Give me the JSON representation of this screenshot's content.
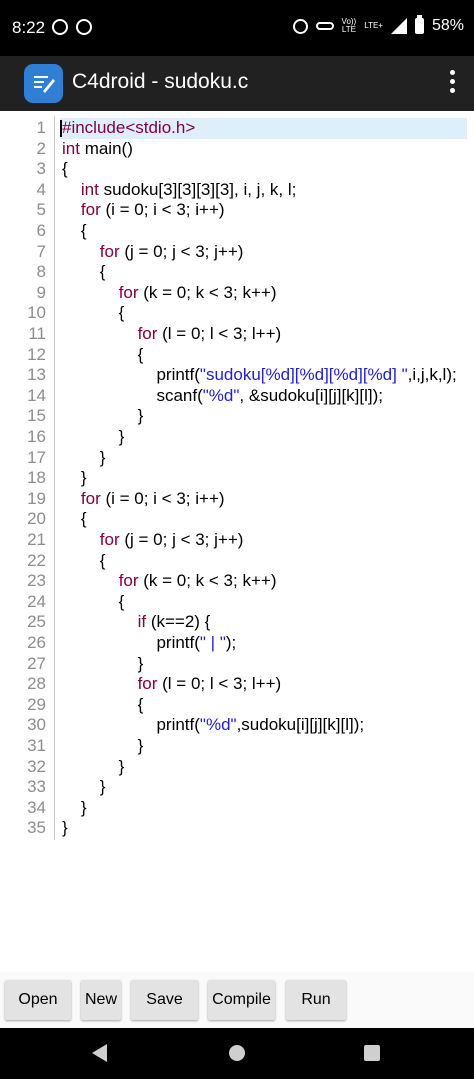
{
  "status_bar": {
    "time": "8:22",
    "network_label_top": "Vo))",
    "network_label_bottom": "LTE",
    "data_label": "LTE+",
    "battery": "58%"
  },
  "app_bar": {
    "title": "C4droid - sudoku.c",
    "logo_icon": "c4droid-app-icon",
    "menu_icon": "overflow-menu-icon"
  },
  "editor": {
    "current_line": 1,
    "lines": [
      {
        "n": "1",
        "segs": [
          [
            "pp",
            "#include<stdio.h>"
          ]
        ]
      },
      {
        "n": "2",
        "segs": [
          [
            "kw",
            "int"
          ],
          [
            "",
            "main()"
          ]
        ]
      },
      {
        "n": "3",
        "segs": [
          [
            "",
            "{"
          ]
        ]
      },
      {
        "n": "4",
        "segs": [
          [
            "",
            "    "
          ],
          [
            "kw",
            "int"
          ],
          [
            "",
            "sudoku[3][3][3][3], i, j, k, l;"
          ]
        ]
      },
      {
        "n": "5",
        "segs": [
          [
            "",
            "    "
          ],
          [
            "kw",
            "for"
          ],
          [
            "",
            "(i = 0; i < 3; i++)"
          ]
        ]
      },
      {
        "n": "6",
        "segs": [
          [
            "",
            "    {"
          ]
        ]
      },
      {
        "n": "7",
        "segs": [
          [
            "",
            "        "
          ],
          [
            "kw",
            "for"
          ],
          [
            "",
            "(j = 0; j < 3; j++)"
          ]
        ]
      },
      {
        "n": "8",
        "segs": [
          [
            "",
            "        {"
          ]
        ]
      },
      {
        "n": "9",
        "segs": [
          [
            "",
            "            "
          ],
          [
            "kw",
            "for"
          ],
          [
            "",
            "(k = 0; k < 3; k++)"
          ]
        ]
      },
      {
        "n": "10",
        "segs": [
          [
            "",
            "            {"
          ]
        ]
      },
      {
        "n": "11",
        "segs": [
          [
            "",
            "                "
          ],
          [
            "kw",
            "for"
          ],
          [
            "",
            "(l = 0; l < 3; l++)"
          ]
        ]
      },
      {
        "n": "12",
        "segs": [
          [
            "",
            "                {"
          ]
        ]
      },
      {
        "n": "13",
        "segs": [
          [
            "",
            "                    printf("
          ],
          [
            "str",
            "\"sudoku[%d][%d][%d][%d] \""
          ],
          [
            "",
            ",i,j,k,l);"
          ]
        ]
      },
      {
        "n": "14",
        "segs": [
          [
            "",
            "                    scanf("
          ],
          [
            "str",
            "\"%d\""
          ],
          [
            "",
            ", &sudoku[i][j][k][l]);"
          ]
        ]
      },
      {
        "n": "15",
        "segs": [
          [
            "",
            "                }"
          ]
        ]
      },
      {
        "n": "16",
        "segs": [
          [
            "",
            "            }"
          ]
        ]
      },
      {
        "n": "17",
        "segs": [
          [
            "",
            "        }"
          ]
        ]
      },
      {
        "n": "18",
        "segs": [
          [
            "",
            "    }"
          ]
        ]
      },
      {
        "n": "19",
        "segs": [
          [
            "",
            "    "
          ],
          [
            "kw",
            "for"
          ],
          [
            "",
            "(i = 0; i < 3; i++)"
          ]
        ]
      },
      {
        "n": "20",
        "segs": [
          [
            "",
            "    {"
          ]
        ]
      },
      {
        "n": "21",
        "segs": [
          [
            "",
            "        "
          ],
          [
            "kw",
            "for"
          ],
          [
            "",
            "(j = 0; j < 3; j++)"
          ]
        ]
      },
      {
        "n": "22",
        "segs": [
          [
            "",
            "        {"
          ]
        ]
      },
      {
        "n": "23",
        "segs": [
          [
            "",
            "            "
          ],
          [
            "kw",
            "for"
          ],
          [
            "",
            "(k = 0; k < 3; k++)"
          ]
        ]
      },
      {
        "n": "24",
        "segs": [
          [
            "",
            "            {"
          ]
        ]
      },
      {
        "n": "25",
        "segs": [
          [
            "",
            "                "
          ],
          [
            "kw",
            "if"
          ],
          [
            "",
            "(k==2) {"
          ]
        ]
      },
      {
        "n": "26",
        "segs": [
          [
            "",
            "                    printf("
          ],
          [
            "str",
            "\" | \""
          ],
          [
            "",
            ");"
          ]
        ]
      },
      {
        "n": "27",
        "segs": [
          [
            "",
            "                }"
          ]
        ]
      },
      {
        "n": "28",
        "segs": [
          [
            "",
            "                "
          ],
          [
            "kw",
            "for"
          ],
          [
            "",
            "(l = 0; l < 3; l++)"
          ]
        ]
      },
      {
        "n": "29",
        "segs": [
          [
            "",
            "                {"
          ]
        ]
      },
      {
        "n": "30",
        "segs": [
          [
            "",
            "                    printf("
          ],
          [
            "str",
            "\"%d\""
          ],
          [
            "",
            ",sudoku[i][j][k][l]);"
          ]
        ]
      },
      {
        "n": "31",
        "segs": [
          [
            "",
            "                }"
          ]
        ]
      },
      {
        "n": "32",
        "segs": [
          [
            "",
            "            }"
          ]
        ]
      },
      {
        "n": "33",
        "segs": [
          [
            "",
            "        }"
          ]
        ]
      },
      {
        "n": "34",
        "segs": [
          [
            "",
            "    }"
          ]
        ]
      },
      {
        "n": "35",
        "segs": [
          [
            "",
            "}"
          ]
        ]
      }
    ]
  },
  "toolbar": {
    "buttons": [
      {
        "id": "open",
        "label": "Open"
      },
      {
        "id": "new",
        "label": "New"
      },
      {
        "id": "save",
        "label": "Save"
      },
      {
        "id": "compile",
        "label": "Compile"
      },
      {
        "id": "run",
        "label": "Run"
      }
    ]
  },
  "nav_bar": {
    "back_icon": "back-triangle-icon",
    "home_icon": "home-circle-icon",
    "recents_icon": "recents-square-icon"
  },
  "colors": {
    "keyword": "#800040",
    "string": "#2020d0",
    "line_number": "#8d8d8d",
    "current_line_highlight": "#dfeefb",
    "app_bar": "#212121",
    "app_icon": "#2f7fd6"
  }
}
